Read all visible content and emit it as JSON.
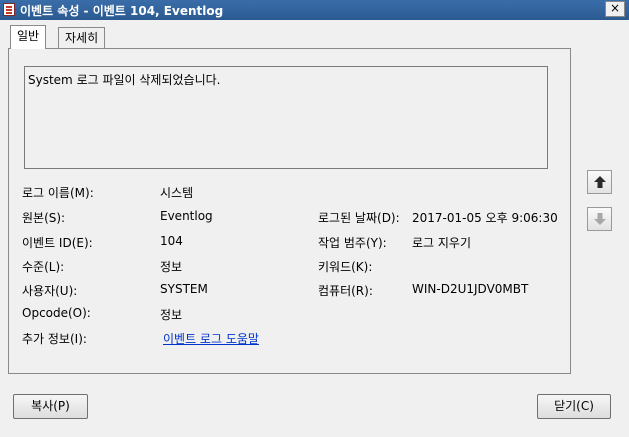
{
  "window": {
    "title": "이벤트 속성 - 이벤트 104, Eventlog",
    "close_label": "×"
  },
  "tabs": [
    {
      "label": "일반"
    },
    {
      "label": "자세히"
    }
  ],
  "description": "System 로그 파일이 삭제되었습니다.",
  "fields": {
    "log_name": {
      "label": "로그 이름(M):",
      "value": "시스템"
    },
    "source": {
      "label": "원본(S):",
      "value": "Eventlog"
    },
    "logged": {
      "label": "로그된 날짜(D):",
      "value": "2017-01-05 오후 9:06:30"
    },
    "event_id": {
      "label": "이벤트 ID(E):",
      "value": "104"
    },
    "task_category": {
      "label": "작업 범주(Y):",
      "value": "로그 지우기"
    },
    "level": {
      "label": "수준(L):",
      "value": "정보"
    },
    "keywords": {
      "label": "키워드(K):",
      "value": ""
    },
    "user": {
      "label": "사용자(U):",
      "value": "SYSTEM"
    },
    "computer": {
      "label": "컴퓨터(R):",
      "value": "WIN-D2U1JDV0MBT"
    },
    "opcode": {
      "label": "Opcode(O):",
      "value": "정보"
    },
    "more_info": {
      "label": "추가 정보(I):",
      "link": "이벤트 로그 도움말"
    }
  },
  "buttons": {
    "copy": "복사(P)",
    "close": "닫기(C)"
  },
  "icons": {
    "up": "arrow-up-icon",
    "down": "arrow-down-icon"
  }
}
